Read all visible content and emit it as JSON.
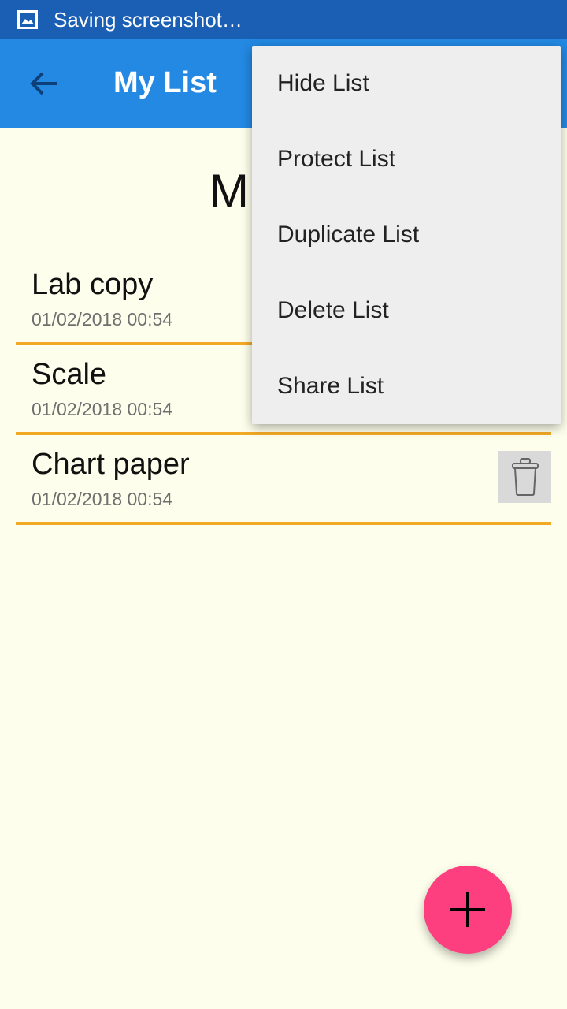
{
  "status_bar": {
    "text": "Saving screenshot…",
    "icon": "image-icon"
  },
  "app_bar": {
    "title": "My List",
    "back_icon": "arrow-back-icon"
  },
  "content": {
    "heading": "M"
  },
  "items": [
    {
      "name": "Lab copy",
      "date": "01/02/2018 00:54"
    },
    {
      "name": "Scale",
      "date": "01/02/2018 00:54"
    },
    {
      "name": "Chart paper",
      "date": "01/02/2018 00:54"
    }
  ],
  "menu": {
    "items": [
      {
        "label": "Hide List"
      },
      {
        "label": "Protect List"
      },
      {
        "label": "Duplicate List"
      },
      {
        "label": "Delete List"
      },
      {
        "label": "Share List"
      }
    ]
  },
  "fab": {
    "icon": "plus-icon"
  },
  "colors": {
    "status_bar": "#1b5fb4",
    "app_bar": "#2389e3",
    "background": "#fefeec",
    "divider": "#f2a926",
    "fab": "#fd3f7f",
    "menu_bg": "#eeeeee"
  }
}
